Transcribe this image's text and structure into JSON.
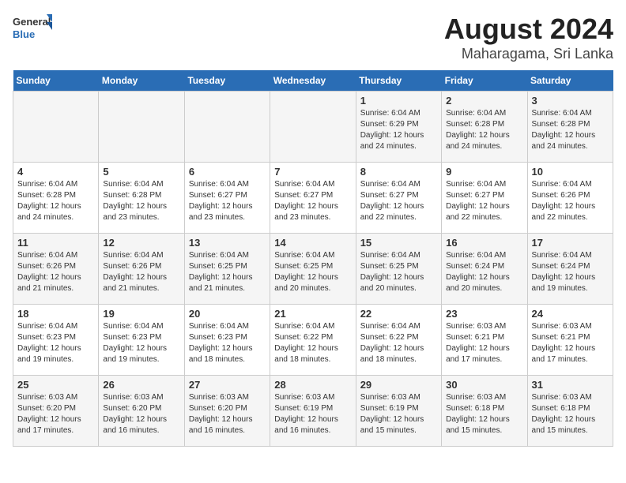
{
  "header": {
    "logo_general": "General",
    "logo_blue": "Blue",
    "title": "August 2024",
    "subtitle": "Maharagama, Sri Lanka"
  },
  "calendar": {
    "days_of_week": [
      "Sunday",
      "Monday",
      "Tuesday",
      "Wednesday",
      "Thursday",
      "Friday",
      "Saturday"
    ],
    "weeks": [
      [
        {
          "day": "",
          "info": ""
        },
        {
          "day": "",
          "info": ""
        },
        {
          "day": "",
          "info": ""
        },
        {
          "day": "",
          "info": ""
        },
        {
          "day": "1",
          "info": "Sunrise: 6:04 AM\nSunset: 6:29 PM\nDaylight: 12 hours\nand 24 minutes."
        },
        {
          "day": "2",
          "info": "Sunrise: 6:04 AM\nSunset: 6:28 PM\nDaylight: 12 hours\nand 24 minutes."
        },
        {
          "day": "3",
          "info": "Sunrise: 6:04 AM\nSunset: 6:28 PM\nDaylight: 12 hours\nand 24 minutes."
        }
      ],
      [
        {
          "day": "4",
          "info": "Sunrise: 6:04 AM\nSunset: 6:28 PM\nDaylight: 12 hours\nand 24 minutes."
        },
        {
          "day": "5",
          "info": "Sunrise: 6:04 AM\nSunset: 6:28 PM\nDaylight: 12 hours\nand 23 minutes."
        },
        {
          "day": "6",
          "info": "Sunrise: 6:04 AM\nSunset: 6:27 PM\nDaylight: 12 hours\nand 23 minutes."
        },
        {
          "day": "7",
          "info": "Sunrise: 6:04 AM\nSunset: 6:27 PM\nDaylight: 12 hours\nand 23 minutes."
        },
        {
          "day": "8",
          "info": "Sunrise: 6:04 AM\nSunset: 6:27 PM\nDaylight: 12 hours\nand 22 minutes."
        },
        {
          "day": "9",
          "info": "Sunrise: 6:04 AM\nSunset: 6:27 PM\nDaylight: 12 hours\nand 22 minutes."
        },
        {
          "day": "10",
          "info": "Sunrise: 6:04 AM\nSunset: 6:26 PM\nDaylight: 12 hours\nand 22 minutes."
        }
      ],
      [
        {
          "day": "11",
          "info": "Sunrise: 6:04 AM\nSunset: 6:26 PM\nDaylight: 12 hours\nand 21 minutes."
        },
        {
          "day": "12",
          "info": "Sunrise: 6:04 AM\nSunset: 6:26 PM\nDaylight: 12 hours\nand 21 minutes."
        },
        {
          "day": "13",
          "info": "Sunrise: 6:04 AM\nSunset: 6:25 PM\nDaylight: 12 hours\nand 21 minutes."
        },
        {
          "day": "14",
          "info": "Sunrise: 6:04 AM\nSunset: 6:25 PM\nDaylight: 12 hours\nand 20 minutes."
        },
        {
          "day": "15",
          "info": "Sunrise: 6:04 AM\nSunset: 6:25 PM\nDaylight: 12 hours\nand 20 minutes."
        },
        {
          "day": "16",
          "info": "Sunrise: 6:04 AM\nSunset: 6:24 PM\nDaylight: 12 hours\nand 20 minutes."
        },
        {
          "day": "17",
          "info": "Sunrise: 6:04 AM\nSunset: 6:24 PM\nDaylight: 12 hours\nand 19 minutes."
        }
      ],
      [
        {
          "day": "18",
          "info": "Sunrise: 6:04 AM\nSunset: 6:23 PM\nDaylight: 12 hours\nand 19 minutes."
        },
        {
          "day": "19",
          "info": "Sunrise: 6:04 AM\nSunset: 6:23 PM\nDaylight: 12 hours\nand 19 minutes."
        },
        {
          "day": "20",
          "info": "Sunrise: 6:04 AM\nSunset: 6:23 PM\nDaylight: 12 hours\nand 18 minutes."
        },
        {
          "day": "21",
          "info": "Sunrise: 6:04 AM\nSunset: 6:22 PM\nDaylight: 12 hours\nand 18 minutes."
        },
        {
          "day": "22",
          "info": "Sunrise: 6:04 AM\nSunset: 6:22 PM\nDaylight: 12 hours\nand 18 minutes."
        },
        {
          "day": "23",
          "info": "Sunrise: 6:03 AM\nSunset: 6:21 PM\nDaylight: 12 hours\nand 17 minutes."
        },
        {
          "day": "24",
          "info": "Sunrise: 6:03 AM\nSunset: 6:21 PM\nDaylight: 12 hours\nand 17 minutes."
        }
      ],
      [
        {
          "day": "25",
          "info": "Sunrise: 6:03 AM\nSunset: 6:20 PM\nDaylight: 12 hours\nand 17 minutes."
        },
        {
          "day": "26",
          "info": "Sunrise: 6:03 AM\nSunset: 6:20 PM\nDaylight: 12 hours\nand 16 minutes."
        },
        {
          "day": "27",
          "info": "Sunrise: 6:03 AM\nSunset: 6:20 PM\nDaylight: 12 hours\nand 16 minutes."
        },
        {
          "day": "28",
          "info": "Sunrise: 6:03 AM\nSunset: 6:19 PM\nDaylight: 12 hours\nand 16 minutes."
        },
        {
          "day": "29",
          "info": "Sunrise: 6:03 AM\nSunset: 6:19 PM\nDaylight: 12 hours\nand 15 minutes."
        },
        {
          "day": "30",
          "info": "Sunrise: 6:03 AM\nSunset: 6:18 PM\nDaylight: 12 hours\nand 15 minutes."
        },
        {
          "day": "31",
          "info": "Sunrise: 6:03 AM\nSunset: 6:18 PM\nDaylight: 12 hours\nand 15 minutes."
        }
      ]
    ]
  }
}
